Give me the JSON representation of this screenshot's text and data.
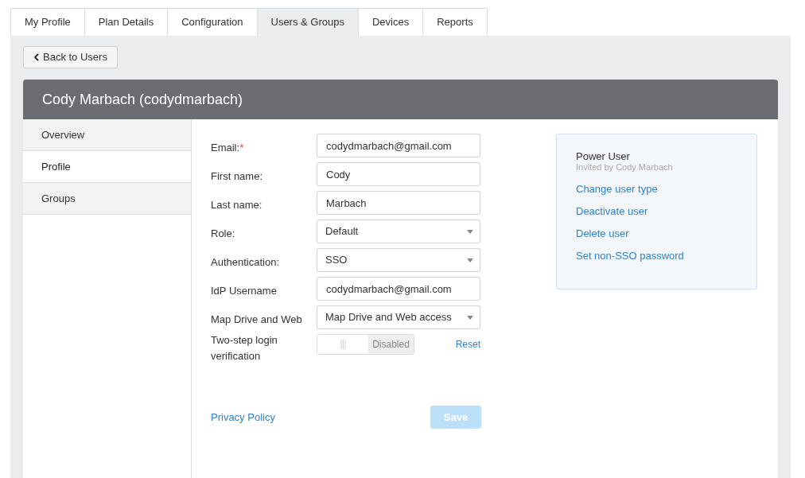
{
  "tabs": [
    {
      "label": "My Profile",
      "selected": false
    },
    {
      "label": "Plan Details",
      "selected": false
    },
    {
      "label": "Configuration",
      "selected": false
    },
    {
      "label": "Users & Groups",
      "selected": true
    },
    {
      "label": "Devices",
      "selected": false
    },
    {
      "label": "Reports",
      "selected": false
    }
  ],
  "back_button": "Back to Users",
  "header": {
    "title": "Cody Marbach (codydmarbach)"
  },
  "sidebar": {
    "items": [
      {
        "label": "Overview",
        "selected": false
      },
      {
        "label": "Profile",
        "selected": true
      },
      {
        "label": "Groups",
        "selected": false
      }
    ]
  },
  "form": {
    "fields": [
      {
        "kind": "text",
        "label": "Email:",
        "required_mark": "*",
        "value": "codydmarbach@gmail.com"
      },
      {
        "kind": "text",
        "label": "First name:",
        "value": "Cody"
      },
      {
        "kind": "text",
        "label": "Last name:",
        "value": "Marbach"
      },
      {
        "kind": "select",
        "label": "Role:",
        "value": "Default"
      },
      {
        "kind": "select",
        "label": "Authentication:",
        "value": "SSO"
      },
      {
        "kind": "text",
        "label": "IdP Username",
        "value": "codydmarbach@gmail.com"
      },
      {
        "kind": "select",
        "label": "Map Drive and Web",
        "value": "Map Drive and Web access"
      },
      {
        "kind": "toggle",
        "label": "Two-step login verification",
        "on": false,
        "value": "Disabled",
        "action": "Reset"
      }
    ],
    "privacy_link": "Privacy Policy",
    "save_button": {
      "label": "Save",
      "disabled": true
    }
  },
  "user_card": {
    "type": "Power User",
    "invited_by": "Invited by Cody Marbach",
    "actions": [
      "Change user type",
      "Deactivate user",
      "Delete user",
      "Set non-SSO password"
    ]
  }
}
